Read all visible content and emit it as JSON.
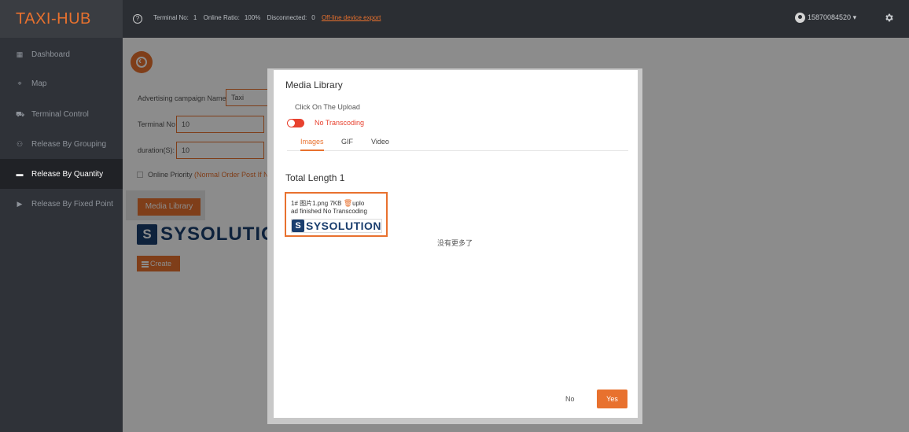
{
  "header": {
    "brand": "TAXI-HUB",
    "help_icon": "question-circle-icon",
    "terminal_no_label": "Terminal No:",
    "terminal_no_value": "1",
    "online_ratio_label": "Online Ratio:",
    "online_ratio_value": "100%",
    "disconnected_label": "Disconnected:",
    "disconnected_value": "0",
    "export_link": "Off-line device export",
    "user_id": "15870084520",
    "user_caret": "▾",
    "settings_icon": "gear-icon"
  },
  "sidebar": {
    "items": [
      {
        "label": "Dashboard",
        "icon": "dashboard-icon"
      },
      {
        "label": "Map",
        "icon": "map-icon"
      },
      {
        "label": "Terminal Control",
        "icon": "car-icon"
      },
      {
        "label": "Release By Grouping",
        "icon": "group-icon"
      },
      {
        "label": "Release By Quantity",
        "icon": "list-icon",
        "active": true
      },
      {
        "label": "Release By Fixed Point",
        "icon": "play-icon"
      }
    ]
  },
  "form": {
    "campaign_label": "Advertising campaign Name",
    "campaign_value": "Taxi",
    "terminal_label": "Terminal No",
    "terminal_value": "10",
    "duration_label": "duration(S):",
    "duration_value": "10",
    "priority_label": "Online Priority",
    "priority_warning": "(Normal Order Post If No",
    "media_button": "Media Library",
    "logo_text": "SYSOLUTION",
    "create_button": "Create"
  },
  "modal": {
    "title": "Media Library",
    "upload_label": "Click On The Upload",
    "transcoding_toggle": "No Transcoding",
    "tabs": [
      "Images",
      "GIF",
      "Video"
    ],
    "active_tab": "Images",
    "total_label": "Total Length",
    "total_value": "1",
    "file": {
      "line1": "1# 图片1.png   7KB",
      "line1_tail": "uplo",
      "line2": "ad finished  No Transcoding",
      "logo_text": "SYSOLUTION"
    },
    "no_more": "没有更多了",
    "btn_no": "No",
    "btn_yes": "Yes"
  },
  "colors": {
    "accent": "#e8712e",
    "header_bg": "#2b2e33",
    "sidebar_bg": "#2f3238",
    "logo_blue": "#1a3e6e"
  }
}
